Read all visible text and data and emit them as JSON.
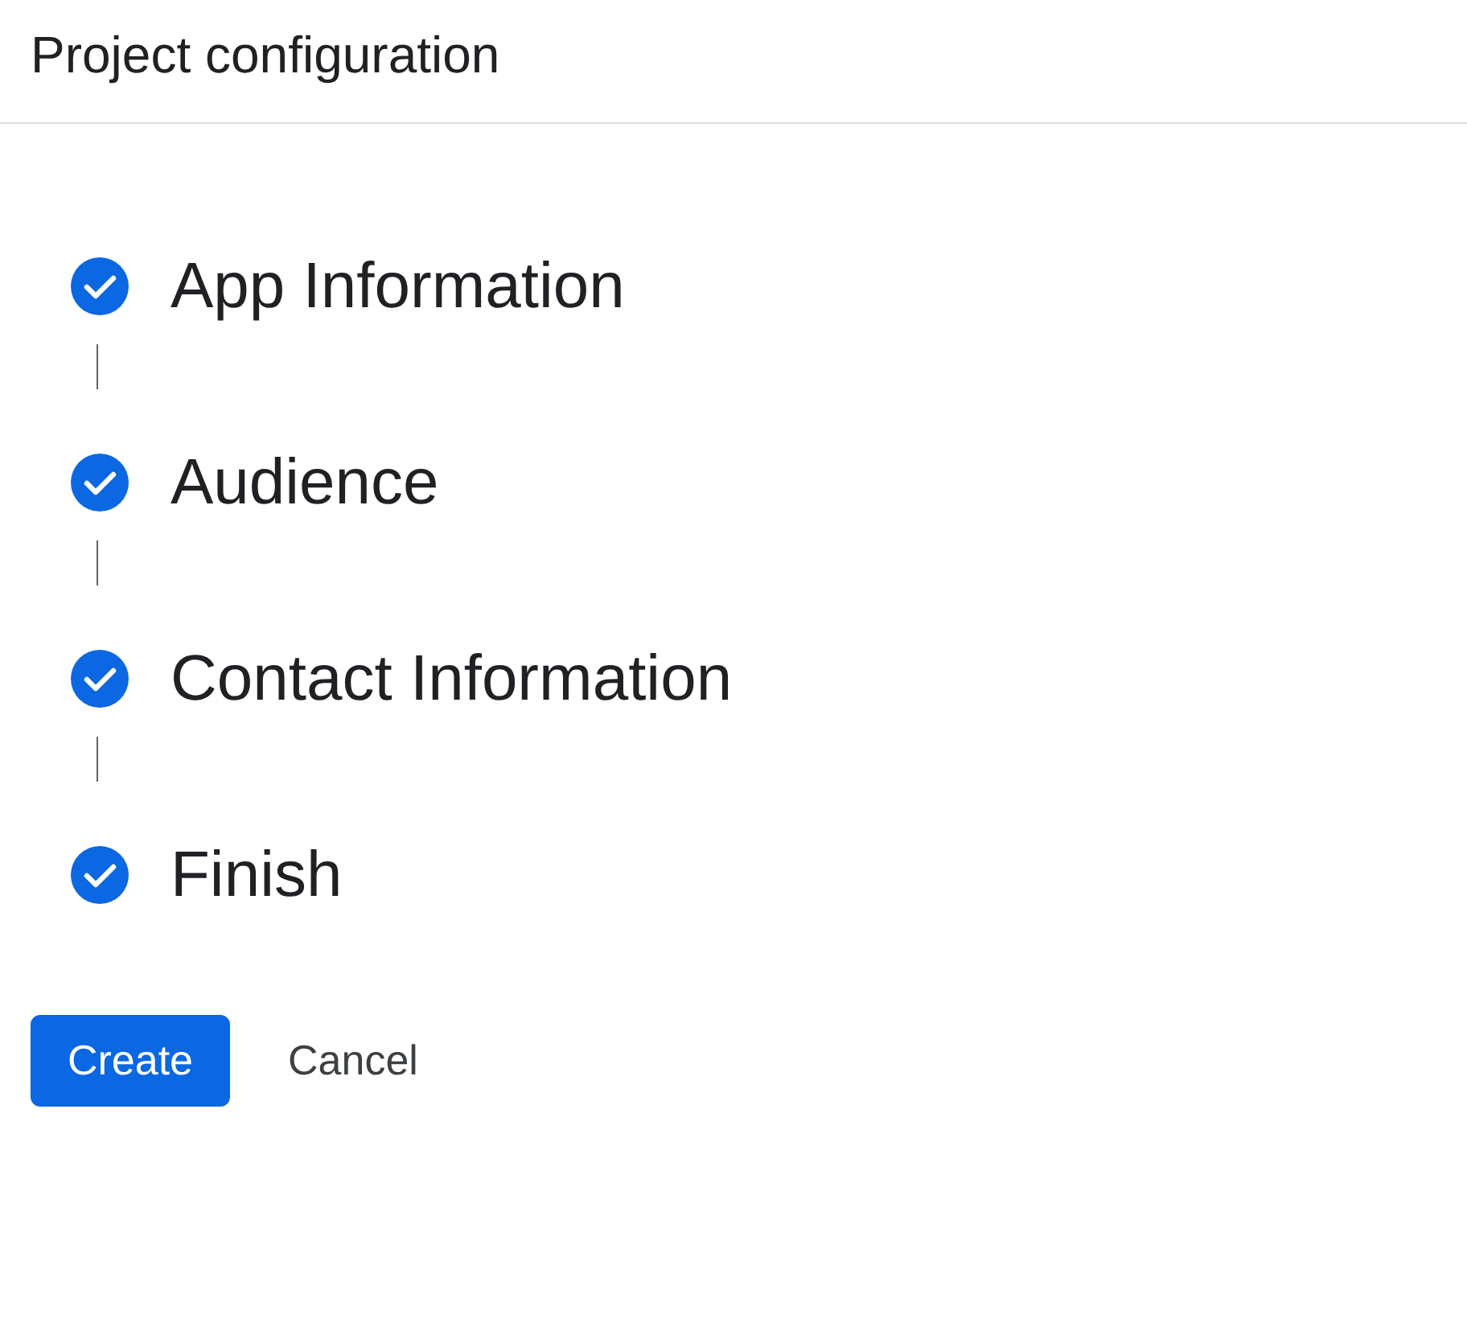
{
  "header": {
    "title": "Project configuration"
  },
  "steps": [
    {
      "label": "App Information",
      "completed": true
    },
    {
      "label": "Audience",
      "completed": true
    },
    {
      "label": "Contact Information",
      "completed": true
    },
    {
      "label": "Finish",
      "completed": true
    }
  ],
  "buttons": [
    {
      "label": "Create",
      "kind": "primary"
    },
    {
      "label": "Cancel",
      "kind": "text"
    }
  ]
}
